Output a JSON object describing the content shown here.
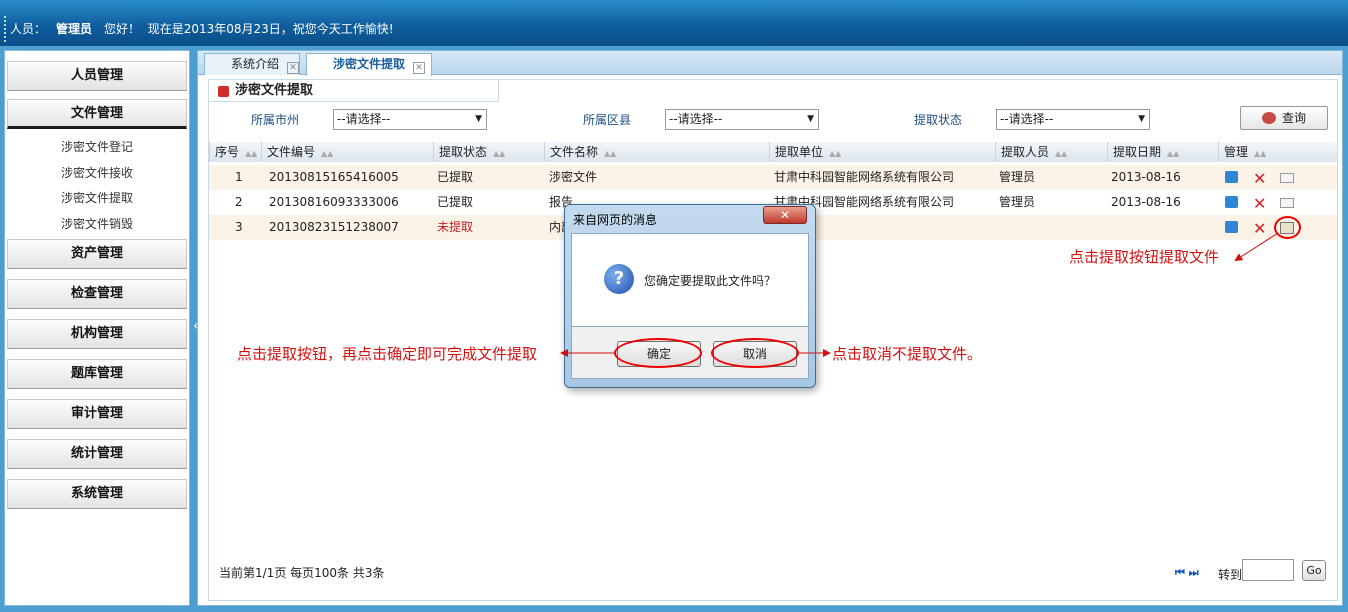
{
  "header": {
    "user_label": "人员：",
    "user_name": "管理员",
    "hello": "您好！",
    "date_text": "现在是2013年08月23日，祝您今天工作愉快!"
  },
  "sidebar": {
    "groups": [
      "人员管理",
      "文件管理",
      "资产管理",
      "检查管理",
      "机构管理",
      "题库管理",
      "审计管理",
      "统计管理",
      "系统管理"
    ],
    "file_subitems": [
      "涉密文件登记",
      "涉密文件接收",
      "涉密文件提取",
      "涉密文件销毁"
    ],
    "collapse_glyph": "«"
  },
  "tabs": [
    {
      "label": "系统介绍"
    },
    {
      "label": "涉密文件提取"
    }
  ],
  "panel": {
    "title": "涉密文件提取",
    "filters": [
      {
        "label": "所属市州",
        "value": "--请选择--"
      },
      {
        "label": "所属区县",
        "value": "--请选择--"
      },
      {
        "label": "提取状态",
        "value": "--请选择--"
      }
    ],
    "query_button": "查询"
  },
  "table": {
    "columns": [
      "序号",
      "文件编号",
      "提取状态",
      "文件名称",
      "提取单位",
      "提取人员",
      "提取日期",
      "管理"
    ],
    "rows": [
      [
        "1",
        "20130815165416005",
        "已提取",
        "涉密文件",
        "甘肃中科园智能网络系统有限公司",
        "管理员",
        "2013-08-16"
      ],
      [
        "2",
        "20130816093333006",
        "已提取",
        "报告",
        "甘肃中科园智能网络系统有限公司",
        "管理员",
        "2013-08-16"
      ],
      [
        "3",
        "20130823151238007",
        "未提取",
        "内部",
        "",
        "",
        ""
      ]
    ]
  },
  "pager": {
    "info": "当前第1/1页  每页100条  共3条",
    "first_last": "⏮ ⏭",
    "goto_label": "转到",
    "go_button": "Go"
  },
  "dialog": {
    "title": "来自网页的消息",
    "close": "✕",
    "message": "您确定要提取此文件吗？",
    "ok": "确定",
    "cancel": "取消"
  },
  "annotations": {
    "click_extract": "点击提取按钮提取文件",
    "confirm_hint": "点击提取按钮，再点击确定即可完成文件提取",
    "cancel_hint": "点击取消不提取文件。"
  },
  "colors": {
    "accent": "#0f5e9e",
    "annotation": "#d21010",
    "unextracted": "#c02020"
  }
}
